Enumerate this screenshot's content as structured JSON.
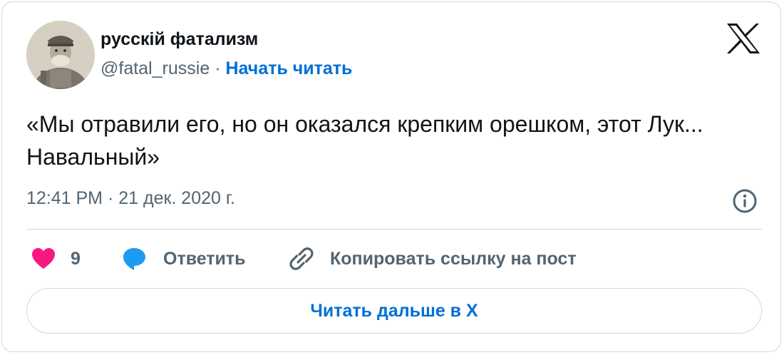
{
  "author": {
    "name": "русскiй фатализм",
    "handle": "@fatal_russie",
    "separator": "·",
    "follow_label": "Начать читать"
  },
  "tweet": {
    "text": "«Мы отравили его, но он оказался крепким орешком, этот Лук... Навальный»",
    "timestamp": "12:41 PM · 21 дек. 2020 г."
  },
  "actions": {
    "like_count": "9",
    "reply_label": "Ответить",
    "copy_link_label": "Копировать ссылку на пост"
  },
  "read_more_label": "Читать дальше в X",
  "icons": {
    "brand": "x-logo-icon",
    "info": "info-icon",
    "like": "heart-icon",
    "reply": "speech-bubble-icon",
    "copy": "link-icon"
  },
  "colors": {
    "text_primary": "#0f1419",
    "text_secondary": "#536471",
    "link": "#006fd6",
    "like": "#f91880",
    "reply": "#1d9bf0",
    "border": "#cfd9de"
  }
}
